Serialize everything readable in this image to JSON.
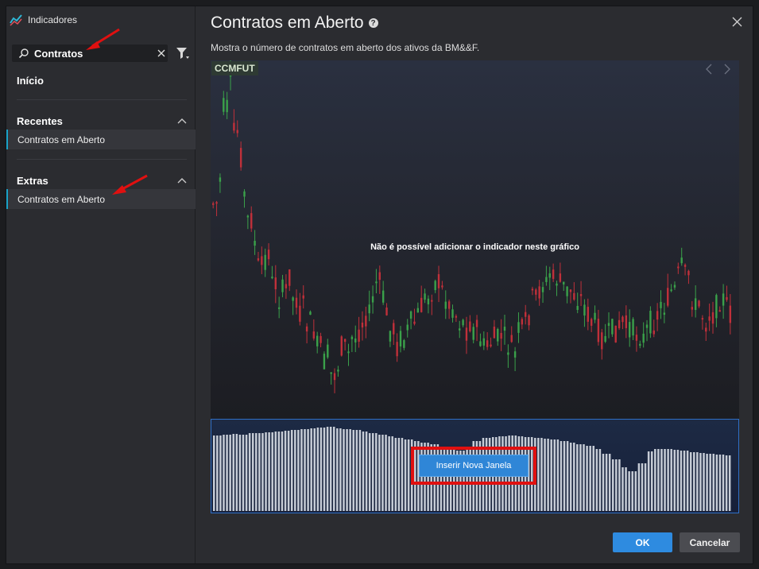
{
  "app": {
    "title": "Indicadores"
  },
  "search": {
    "value": "Contratos",
    "placeholder": ""
  },
  "sidebar": {
    "home_label": "Início",
    "sections": [
      {
        "title": "Recentes",
        "items": [
          {
            "label": "Contratos em Aberto"
          }
        ]
      },
      {
        "title": "Extras",
        "items": [
          {
            "label": "Contratos em Aberto"
          }
        ]
      }
    ]
  },
  "indicator": {
    "title": "Contratos em Aberto",
    "description": "Mostra o número de contratos em aberto dos ativos da BM&&F."
  },
  "chart": {
    "ticker": "CCMFUT",
    "message": "Não é possível adicionar o indicador neste gráfico",
    "up_color": "#3aa14a",
    "down_color": "#c0303a"
  },
  "volume_panel": {
    "insert_label": "Inserir Nova Janela"
  },
  "footer": {
    "ok_label": "OK",
    "cancel_label": "Cancelar"
  },
  "colors": {
    "accent": "#2e8be0",
    "selection_bar": "#1aa3c9",
    "highlight": "#e01010"
  },
  "icons": [
    "app-logo-icon",
    "search-icon",
    "clear-icon",
    "filter-icon",
    "chevron-up-icon",
    "help-icon",
    "close-icon",
    "chevron-left-icon",
    "chevron-right-icon",
    "red-arrow-icon"
  ]
}
